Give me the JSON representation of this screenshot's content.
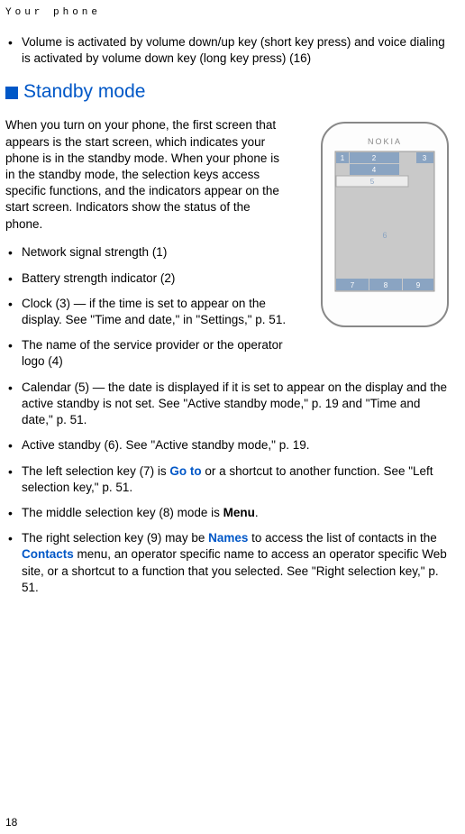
{
  "runningHead": "Your phone",
  "topBullet": "Volume is activated by volume down/up key (short key press) and voice dialing is activated by volume down key (long key press) (16)",
  "section": {
    "title": "Standby mode",
    "intro": "When you turn on your phone, the first screen that appears is the start screen, which indicates your phone is in the standby mode. When your phone is in the standby mode, the selection keys access specific functions, and the indicators appear on the start screen. Indicators show the status of the phone.",
    "items": [
      {
        "pre": "Network signal strength (1)",
        "link": "",
        "post": ""
      },
      {
        "pre": "Battery strength indicator (2)",
        "link": "",
        "post": ""
      },
      {
        "pre": "Clock (3) — if the time is set to appear on the display. See \"Time and date,\" in \"Settings,\" p. 51.",
        "link": "",
        "post": ""
      },
      {
        "pre": "The name of the service provider or the operator logo (4)",
        "link": "",
        "post": ""
      },
      {
        "pre": "Calendar (5) — the date is displayed if it is set to appear on the display and the active standby is not set. See \"Active standby mode,\" p. 19 and \"Time and date,\" p. 51.",
        "link": "",
        "post": ""
      },
      {
        "pre": "Active standby (6). See \"Active standby mode,\" p. 19.",
        "link": "",
        "post": ""
      },
      {
        "pre": "The left selection key (7) is ",
        "link": "Go to",
        "post": " or a shortcut to another function. See \"Left selection key,\" p. 51."
      },
      {
        "pre": "The middle selection key (8) mode is ",
        "link": "Menu",
        "post": "."
      },
      {
        "pre": "The right selection key (9) may be ",
        "link": "Names",
        "post": " to access the list of contacts in the ",
        "link2": "Contacts",
        "post2": " menu, an operator specific name to access an operator specific Web site, or a shortcut to a function that you selected. See \"Right selection key,\" p. 51."
      }
    ]
  },
  "phoneLabels": {
    "brand": "NOKIA",
    "n1": "1",
    "n2": "2",
    "n3": "3",
    "n4": "4",
    "n5": "5",
    "n6": "6",
    "n7": "7",
    "n8": "8",
    "n9": "9"
  },
  "pageNumber": "18"
}
